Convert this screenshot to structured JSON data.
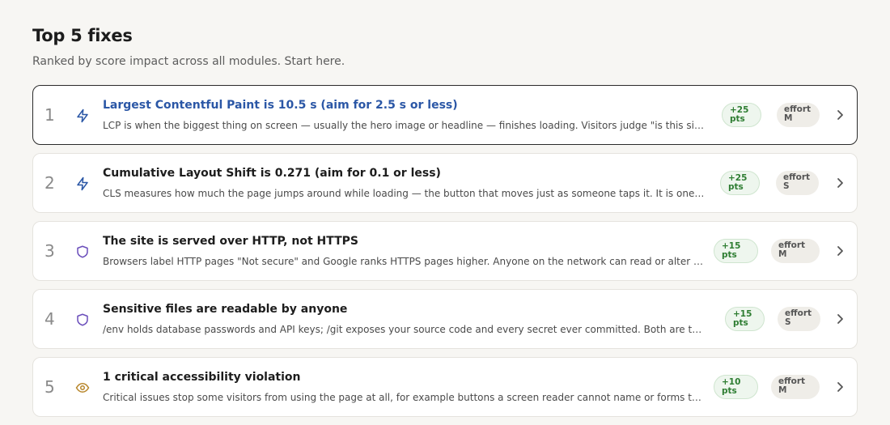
{
  "header": {
    "title": "Top 5 fixes",
    "subtitle": "Ranked by score impact across all modules. Start here."
  },
  "fixes": [
    {
      "rank": "1",
      "icon": "lightning-icon",
      "title": "Largest Contentful Paint is 10.5 s (aim for 2.5 s or less)",
      "description": "LCP is when the biggest thing on screen — usually the hero image or headline — finishes loading. Visitors judge \"is this site sl…",
      "points": [
        "+25",
        "pts"
      ],
      "effort": [
        "effort",
        "M"
      ],
      "active": true
    },
    {
      "rank": "2",
      "icon": "lightning-icon",
      "title": "Cumulative Layout Shift is 0.271 (aim for 0.1 or less)",
      "description": "CLS measures how much the page jumps around while loading — the button that moves just as someone taps it. It is one of G…",
      "points": [
        "+25",
        "pts"
      ],
      "effort": [
        "effort",
        "S"
      ],
      "active": false
    },
    {
      "rank": "3",
      "icon": "shield-icon",
      "title": "The site is served over HTTP, not HTTPS",
      "description": "Browsers label HTTP pages \"Not secure\" and Google ranks HTTPS pages higher. Anyone on the network can read or alter w…",
      "points": [
        "+15",
        "pts"
      ],
      "effort": [
        "effort",
        "M"
      ],
      "active": false
    },
    {
      "rank": "4",
      "icon": "shield-icon",
      "title": "Sensitive files are readable by anyone",
      "description": "/env holds database passwords and API keys; /git exposes your source code and every secret ever committed. Both are the fir…",
      "points": [
        "+15",
        "pts"
      ],
      "effort": [
        "effort",
        "S"
      ],
      "active": false
    },
    {
      "rank": "5",
      "icon": "eye-icon",
      "title": "1 critical accessibility violation",
      "description": "Critical issues stop some visitors from using the page at all, for example buttons a screen reader cannot name or forms that …",
      "points": [
        "+10",
        "pts"
      ],
      "effort": [
        "effort",
        "M"
      ],
      "active": false
    }
  ],
  "colors": {
    "background": "#f7f6f3",
    "active_title": "#2b57a6",
    "lightning_icon": "#2b57a6",
    "shield_icon": "#6b4fbb",
    "eye_icon": "#b8862b",
    "points_badge_bg": "#eef6ee",
    "points_badge_text": "#2e7d32",
    "effort_badge_bg": "#efede8"
  }
}
